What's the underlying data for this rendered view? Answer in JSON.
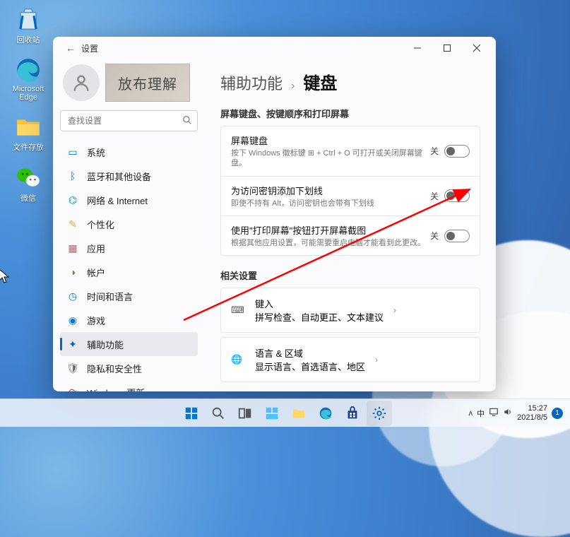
{
  "desktop": {
    "icons": [
      {
        "label": "回收站"
      },
      {
        "label": "Microsoft Edge"
      },
      {
        "label": "文件存放"
      },
      {
        "label": "微信"
      }
    ]
  },
  "window": {
    "app_title": "设置",
    "profile_img_text": "放布理解",
    "search_placeholder": "查找设置",
    "nav": [
      {
        "label": "系统",
        "color": "#0078d4"
      },
      {
        "label": "蓝牙和其他设备",
        "color": "#0078d4"
      },
      {
        "label": "网络 & Internet",
        "color": "#0099bc"
      },
      {
        "label": "个性化",
        "color": "#e8a33d"
      },
      {
        "label": "应用",
        "color": "#c7566c"
      },
      {
        "label": "帐户",
        "color": "#5b8f3e"
      },
      {
        "label": "时间和语言",
        "color": "#0078d4"
      },
      {
        "label": "游戏",
        "color": "#0078d4"
      },
      {
        "label": "辅助功能",
        "color": "#0067c0"
      },
      {
        "label": "隐私和安全性",
        "color": "#6b6b6b"
      },
      {
        "label": "Windows 更新",
        "color": "#d04a2b"
      }
    ],
    "breadcrumb": {
      "parent": "辅助功能",
      "current": "键盘"
    },
    "section1_title": "屏幕键盘、按键顺序和打印屏幕",
    "toggles": [
      {
        "title": "屏幕键盘",
        "desc": "按下 Windows 徽标键 ⊞ + Ctrl + O 可打开或关闭屏幕键盘。",
        "state": "关"
      },
      {
        "title": "为访问密钥添加下划线",
        "desc": "即使不持有 Alt，访问密钥也会带有下划线",
        "state": "关"
      },
      {
        "title": "使用\"打印屏幕\"按钮打开屏幕截图",
        "desc": "根据其他应用设置，可能需要重启电脑才能看到此更改。",
        "state": "关"
      }
    ],
    "section2_title": "相关设置",
    "related": [
      {
        "title": "键入",
        "desc": "拼写检查、自动更正、文本建议"
      },
      {
        "title": "语言 & 区域",
        "desc": "显示语言、首选语言、地区"
      }
    ]
  },
  "taskbar": {
    "tray": {
      "chevron": "ᴧ",
      "ime": "中",
      "time": "15:27",
      "date": "2021/8/5",
      "badge": "1"
    }
  }
}
